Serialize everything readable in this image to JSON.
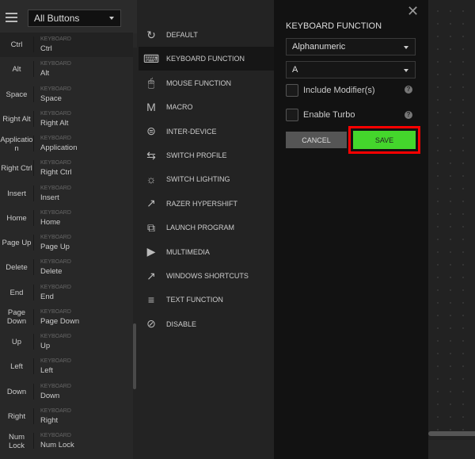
{
  "left": {
    "filter": "All Buttons",
    "type_label": "KEYBOARD",
    "rows": [
      {
        "key": "Ctrl",
        "value": "Ctrl"
      },
      {
        "key": "Alt",
        "value": "Alt"
      },
      {
        "key": "Space",
        "value": "Space"
      },
      {
        "key": "Right Alt",
        "value": "Right Alt"
      },
      {
        "key": "Applicatio n",
        "value": "Application"
      },
      {
        "key": "Right Ctrl",
        "value": "Right Ctrl"
      },
      {
        "key": "Insert",
        "value": "Insert"
      },
      {
        "key": "Home",
        "value": "Home"
      },
      {
        "key": "Page Up",
        "value": "Page Up"
      },
      {
        "key": "Delete",
        "value": "Delete"
      },
      {
        "key": "End",
        "value": "End"
      },
      {
        "key": "Page Down",
        "value": "Page Down"
      },
      {
        "key": "Up",
        "value": "Up"
      },
      {
        "key": "Left",
        "value": "Left"
      },
      {
        "key": "Down",
        "value": "Down"
      },
      {
        "key": "Right",
        "value": "Right"
      },
      {
        "key": "Num Lock",
        "value": "Num Lock"
      }
    ]
  },
  "middle": {
    "items": [
      {
        "label": "DEFAULT",
        "icon": "refresh-icon",
        "glyph": "↻"
      },
      {
        "label": "KEYBOARD FUNCTION",
        "icon": "keyboard-icon",
        "glyph": "⌨"
      },
      {
        "label": "MOUSE FUNCTION",
        "icon": "mouse-icon",
        "glyph": "🖱"
      },
      {
        "label": "MACRO",
        "icon": "macro-icon",
        "glyph": "M"
      },
      {
        "label": "INTER-DEVICE",
        "icon": "inter-device-icon",
        "glyph": "⊜"
      },
      {
        "label": "SWITCH PROFILE",
        "icon": "switch-icon",
        "glyph": "⇆"
      },
      {
        "label": "SWITCH LIGHTING",
        "icon": "sun-icon",
        "glyph": "☼"
      },
      {
        "label": "RAZER HYPERSHIFT",
        "icon": "arrow-icon",
        "glyph": "↗"
      },
      {
        "label": "LAUNCH PROGRAM",
        "icon": "launch-icon",
        "glyph": "⧉"
      },
      {
        "label": "MULTIMEDIA",
        "icon": "play-icon",
        "glyph": "▶"
      },
      {
        "label": "WINDOWS SHORTCUTS",
        "icon": "arrow-icon",
        "glyph": "↗"
      },
      {
        "label": "TEXT FUNCTION",
        "icon": "text-icon",
        "glyph": "≡"
      },
      {
        "label": "DISABLE",
        "icon": "disable-icon",
        "glyph": "⊘"
      }
    ],
    "selected": 1
  },
  "right": {
    "title": "KEYBOARD FUNCTION",
    "category": "Alphanumeric",
    "key": "A",
    "include_modifiers": "Include Modifier(s)",
    "enable_turbo": "Enable Turbo",
    "help": "?",
    "cancel": "CANCEL",
    "save": "SAVE",
    "close": "✕"
  },
  "colors": {
    "accent": "#44d62c",
    "highlight": "#ff0000"
  }
}
